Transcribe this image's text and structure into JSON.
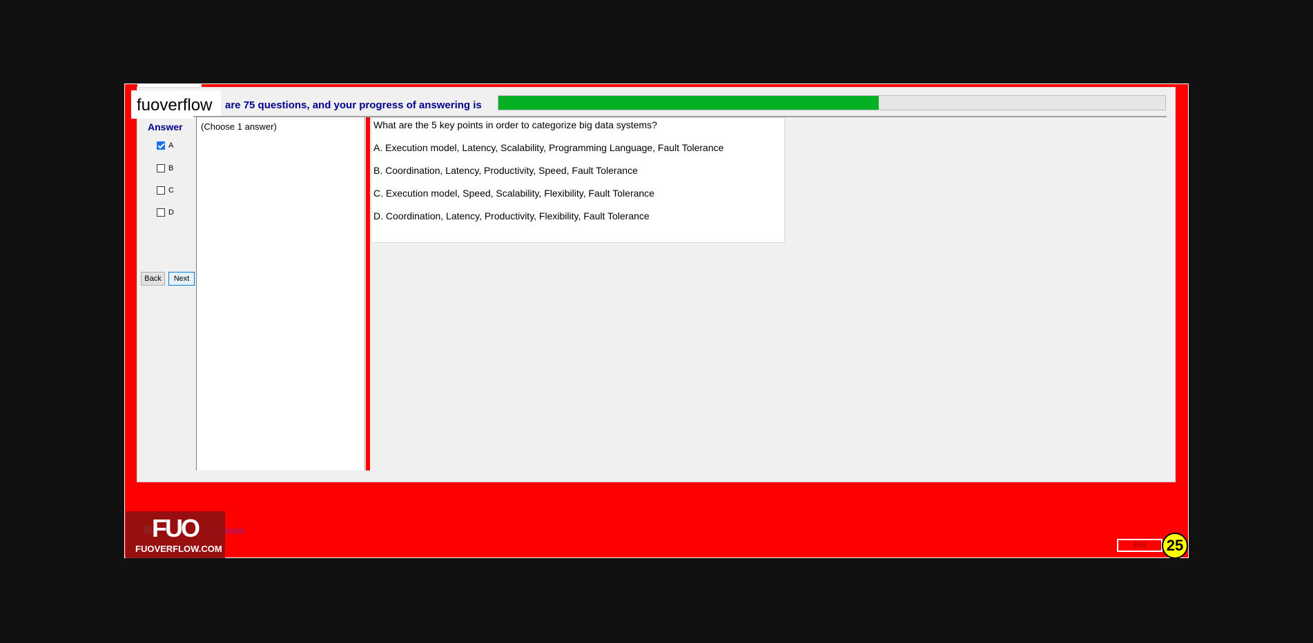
{
  "header": {
    "brand": "fuoverflow",
    "progress_text": "are 75 questions, and your progress of answering is",
    "progress_fraction": 0.57,
    "progress_color": "#06b025"
  },
  "answer_panel": {
    "title": "Answer",
    "options": [
      {
        "label": "A",
        "checked": true
      },
      {
        "label": "B",
        "checked": false
      },
      {
        "label": "C",
        "checked": false
      },
      {
        "label": "D",
        "checked": false
      }
    ],
    "back_label": "Back",
    "next_label": "Next"
  },
  "instruction": "(Choose 1 answer)",
  "question": {
    "text": "What are the 5 key points in order to categorize big data systems?",
    "options": [
      "A.  Execution model, Latency, Scalability, Programming Language, Fault Tolerance",
      "B.  Coordination, Latency, Productivity, Speed, Fault Tolerance",
      "C.  Execution model, Speed, Scalability, Flexibility, Fault Tolerance",
      "D.  Coordination, Latency, Productivity, Flexibility, Fault Tolerance"
    ]
  },
  "footer": {
    "logo_mark": "FUO",
    "logo_site": "FUOVERFLOW.COM",
    "finish_text": "ish the exam",
    "exit_label": "Exit",
    "timer": "25"
  },
  "colors": {
    "window_bg": "#ff0000",
    "accent_text": "#00008b"
  }
}
